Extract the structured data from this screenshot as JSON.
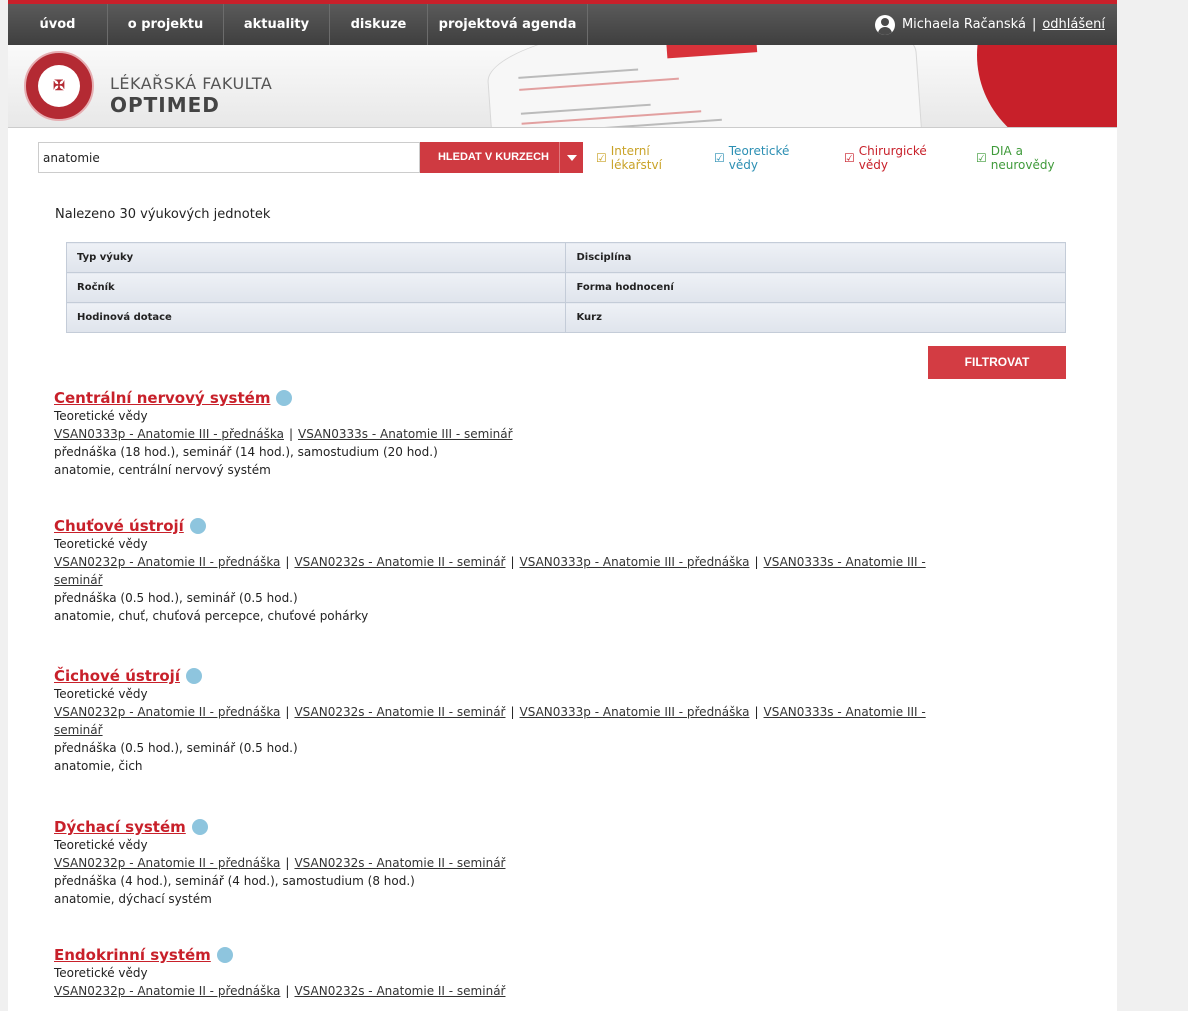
{
  "nav": {
    "items": [
      "úvod",
      "o projektu",
      "aktuality",
      "diskuze",
      "projektová agenda"
    ],
    "user_name": "Michaela Račanská",
    "separator": "|",
    "logout": "odhlášení"
  },
  "brand": {
    "line1": "LÉKAŘSKÁ FAKULTA",
    "line2": "OPTIMED"
  },
  "search": {
    "value": "anatomie",
    "button": "HLEDAT V KURZECH"
  },
  "filters": [
    {
      "label": "Interní lékařství",
      "color": "#c9a227",
      "checked": true
    },
    {
      "label": "Teoretické vědy",
      "color": "#2c8fb3",
      "checked": true
    },
    {
      "label": "Chirurgické vědy",
      "color": "#c8202a",
      "checked": true
    },
    {
      "label": "DIA a neurovědy",
      "color": "#3f9a3a",
      "checked": true
    }
  ],
  "results_count_text": "Nalezeno 30 výukových jednotek",
  "filter_table": {
    "rows": [
      [
        "Typ výuky",
        "Disciplína"
      ],
      [
        "Ročník",
        "Forma hodnocení"
      ],
      [
        "Hodinová dotace",
        "Kurz"
      ]
    ]
  },
  "filter_button": "FILTROVAT",
  "results": [
    {
      "title": "Centrální nervový systém",
      "category": "Teoretické vědy",
      "courses_line1": [
        "VSAN0333p - Anatomie III - přednáška",
        "VSAN0333s - Anatomie III - seminář"
      ],
      "courses_line2": [],
      "hours": "přednáška (18 hod.), seminář (14 hod.), samostudium (20 hod.)",
      "keywords": "anatomie, centrální nervový systém"
    },
    {
      "title": "Chuťové ústrojí",
      "category": "Teoretické vědy",
      "courses_line1": [
        "VSAN0232p - Anatomie II - přednáška",
        "VSAN0232s - Anatomie II - seminář",
        "VSAN0333p - Anatomie III - přednáška",
        "VSAN0333s - Anatomie III -"
      ],
      "courses_line2": [
        "seminář"
      ],
      "hours": "přednáška (0.5 hod.), seminář (0.5 hod.)",
      "keywords": "anatomie, chuť, chuťová percepce, chuťové pohárky"
    },
    {
      "title": "Čichové ústrojí",
      "category": "Teoretické vědy",
      "courses_line1": [
        "VSAN0232p - Anatomie II - přednáška",
        "VSAN0232s - Anatomie II - seminář",
        "VSAN0333p - Anatomie III - přednáška",
        "VSAN0333s - Anatomie III -"
      ],
      "courses_line2": [
        "seminář"
      ],
      "hours": "přednáška (0.5 hod.), seminář (0.5 hod.)",
      "keywords": "anatomie, čich"
    },
    {
      "title": "Dýchací systém",
      "category": "Teoretické vědy",
      "courses_line1": [
        "VSAN0232p - Anatomie II - přednáška",
        "VSAN0232s - Anatomie II - seminář"
      ],
      "courses_line2": [],
      "hours": "přednáška (4 hod.), seminář (4 hod.), samostudium (8 hod.)",
      "keywords": "anatomie, dýchací systém"
    },
    {
      "title": "Endokrinní systém",
      "category": "Teoretické vědy",
      "courses_line1": [
        "VSAN0232p - Anatomie II - přednáška",
        "VSAN0232s - Anatomie II - seminář"
      ],
      "courses_line2": [],
      "hours": "",
      "keywords": ""
    }
  ]
}
